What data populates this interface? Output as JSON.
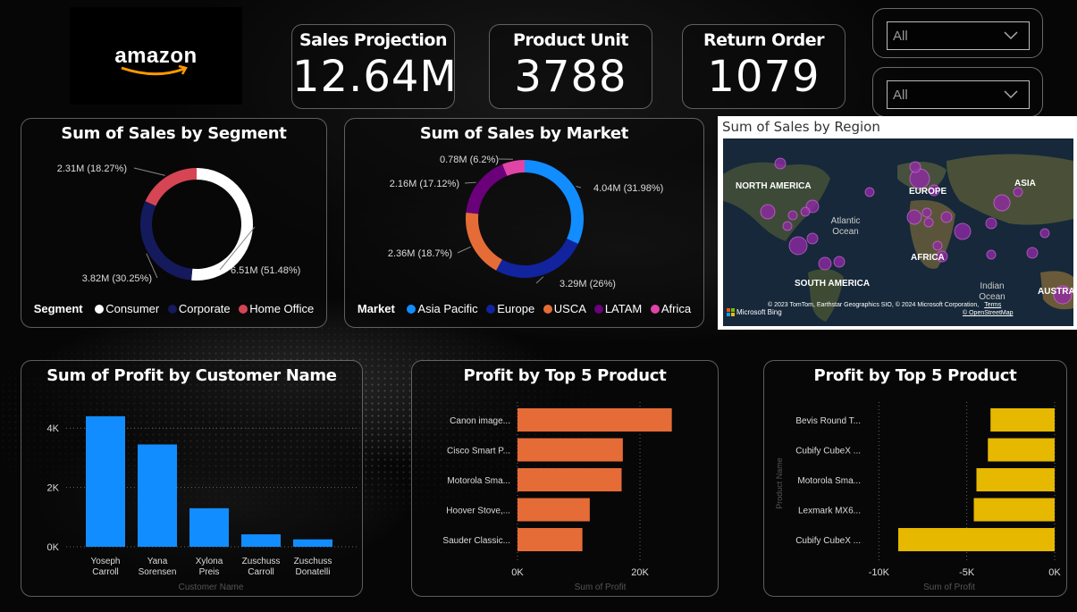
{
  "logo": {
    "text": "amazon"
  },
  "kpis": [
    {
      "title": "Sales Projection",
      "value": "12.64M"
    },
    {
      "title": "Product Unit",
      "value": "3788"
    },
    {
      "title": "Return Order",
      "value": "1079"
    }
  ],
  "slicers": [
    {
      "value": "All"
    },
    {
      "value": "All"
    }
  ],
  "segment_chart": {
    "title": "Sum of Sales by Segment",
    "legend_title": "Segment",
    "slices": [
      {
        "name": "Consumer",
        "value": 6.51,
        "label": "6.51M (51.48%)",
        "color": "#ffffff"
      },
      {
        "name": "Corporate",
        "value": 3.82,
        "label": "3.82M (30.25%)",
        "color": "#151a5c"
      },
      {
        "name": "Home Office",
        "value": 2.31,
        "label": "2.31M (18.27%)",
        "color": "#d64553"
      }
    ]
  },
  "market_chart": {
    "title": "Sum of Sales by Market",
    "legend_title": "Market",
    "slices": [
      {
        "name": "Asia Pacific",
        "value": 4.04,
        "label": "4.04M (31.98%)",
        "color": "#118dff"
      },
      {
        "name": "Europe",
        "value": 3.29,
        "label": "3.29M (26%)",
        "color": "#12239e"
      },
      {
        "name": "USCA",
        "value": 2.36,
        "label": "2.36M (18.7%)",
        "color": "#e66c37"
      },
      {
        "name": "LATAM",
        "value": 2.16,
        "label": "2.16M (17.12%)",
        "color": "#6b007b"
      },
      {
        "name": "Africa",
        "value": 0.78,
        "label": "0.78M (6.2%)",
        "color": "#e044a7"
      }
    ]
  },
  "map": {
    "title": "Sum of Sales by Region",
    "labels": [
      "NORTH AMERICA",
      "EUROPE",
      "ASIA",
      "Atlantic Ocean",
      "AFRICA",
      "SOUTH AMERICA",
      "Indian Ocean",
      "AUSTRA"
    ],
    "attribution": "© 2023 TomTom, Earthstar Geographics SIO, © 2024 Microsoft Corporation,",
    "terms": "Terms",
    "osm": "© OpenStreetMap",
    "bing": "Microsoft Bing"
  },
  "chart_data": [
    {
      "type": "bar",
      "title": "Sum of Profit by Customer Name",
      "xlabel": "Customer Name",
      "ylabel": "",
      "categories": [
        "Yoseph Carroll",
        "Yana Sorensen",
        "Xylona Preis",
        "Zuschuss Carroll",
        "Zuschuss Donatelli"
      ],
      "values": [
        4400,
        3450,
        1300,
        420,
        250
      ],
      "ylim": [
        0,
        5000
      ],
      "yticks": [
        "0K",
        "2K",
        "4K"
      ],
      "color": "#118dff"
    },
    {
      "type": "bar",
      "orientation": "horizontal",
      "title": "Profit by Top 5 Product",
      "xlabel": "Sum of Profit",
      "categories": [
        "Canon image...",
        "Cisco Smart P...",
        "Motorola Sma...",
        "Hoover Stove,...",
        "Sauder Classic..."
      ],
      "values": [
        25200,
        17200,
        17000,
        11800,
        10600
      ],
      "xlim": [
        0,
        27000
      ],
      "xticks": [
        "0K",
        "20K"
      ],
      "color": "#e66c37"
    },
    {
      "type": "bar",
      "orientation": "horizontal",
      "title": "Profit by Top 5 Product",
      "xlabel": "Sum of Profit",
      "ylabel": "Product Name",
      "categories": [
        "Bevis Round T...",
        "Cubify CubeX ...",
        "Motorola Sma...",
        "Lexmark MX6...",
        "Cubify CubeX ..."
      ],
      "values": [
        -3650,
        -3800,
        -4450,
        -4600,
        -8900
      ],
      "xlim": [
        -12000,
        0
      ],
      "xticks": [
        "-10K",
        "-5K",
        "0K"
      ],
      "color": "#e6b800"
    }
  ]
}
